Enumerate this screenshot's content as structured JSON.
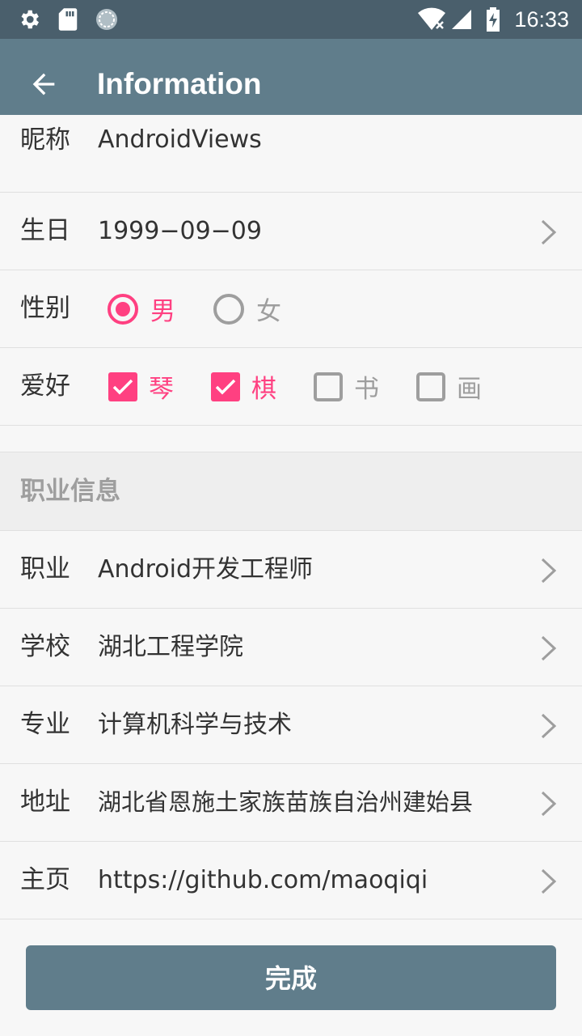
{
  "status_bar": {
    "time": "16:33",
    "icons": [
      "settings-icon",
      "sd-card-icon",
      "sync-icon",
      "wifi-icon",
      "signal-icon",
      "battery-charging-icon"
    ]
  },
  "app_bar": {
    "title": "Information",
    "back_icon": "arrow-back-icon"
  },
  "form": {
    "nickname": {
      "label": "昵称",
      "value": "AndroidViews"
    },
    "birthday": {
      "label": "生日",
      "value": "1999−09−09"
    },
    "gender": {
      "label": "性别",
      "options": [
        {
          "label": "男",
          "checked": true
        },
        {
          "label": "女",
          "checked": false
        }
      ]
    },
    "hobbies": {
      "label": "爱好",
      "options": [
        {
          "label": "琴",
          "checked": true
        },
        {
          "label": "棋",
          "checked": true
        },
        {
          "label": "书",
          "checked": false
        },
        {
          "label": "画",
          "checked": false
        }
      ]
    }
  },
  "career_section": {
    "title": "职业信息",
    "rows": [
      {
        "label": "职业",
        "value": "Android开发工程师"
      },
      {
        "label": "学校",
        "value": "湖北工程学院"
      },
      {
        "label": "专业",
        "value": "计算机科学与技术"
      },
      {
        "label": "地址",
        "value": "湖北省恩施土家族苗族自治州建始县"
      },
      {
        "label": "主页",
        "value": "https://github.com/maoqiqi"
      }
    ]
  },
  "done_button": {
    "label": "完成"
  },
  "colors": {
    "status_bar": "#4a5f6c",
    "app_bar": "#607d8b",
    "accent": "#ff4081",
    "unchecked": "#9e9e9e",
    "background": "#f7f7f7",
    "section_bg": "#eeeeee"
  }
}
